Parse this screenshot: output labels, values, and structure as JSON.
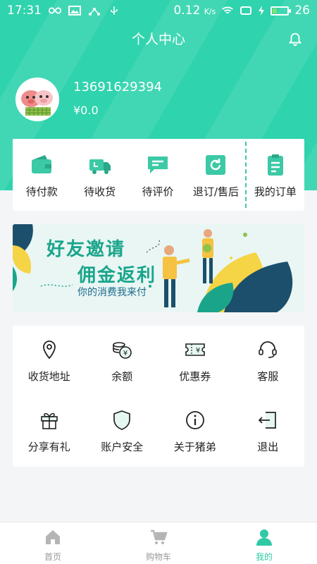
{
  "status_bar": {
    "time": "17:31",
    "net_speed": "0.12",
    "net_unit": "K/s",
    "battery": "26"
  },
  "header": {
    "title": "个人中心"
  },
  "profile": {
    "phone": "13691629394",
    "balance": "¥0.0"
  },
  "orders": [
    {
      "label": "待付款",
      "icon": "wallet-icon"
    },
    {
      "label": "待收货",
      "icon": "truck-icon"
    },
    {
      "label": "待评价",
      "icon": "comment-icon"
    },
    {
      "label": "退订/售后",
      "icon": "refresh-icon"
    },
    {
      "label": "我的订单",
      "icon": "clipboard-icon"
    }
  ],
  "banner": {
    "line1": "好友邀请",
    "line2": "佣金返利",
    "line3": "你的消费我来付"
  },
  "services": [
    {
      "label": "收货地址",
      "icon": "location-icon"
    },
    {
      "label": "余额",
      "icon": "coins-icon"
    },
    {
      "label": "优惠券",
      "icon": "coupon-icon"
    },
    {
      "label": "客服",
      "icon": "headset-icon"
    },
    {
      "label": "分享有礼",
      "icon": "gift-icon"
    },
    {
      "label": "账户安全",
      "icon": "shield-icon"
    },
    {
      "label": "关于猪弟",
      "icon": "info-icon"
    },
    {
      "label": "退出",
      "icon": "logout-icon"
    }
  ],
  "tabs": [
    {
      "label": "首页",
      "icon": "home-icon"
    },
    {
      "label": "购物车",
      "icon": "cart-icon"
    },
    {
      "label": "我的",
      "icon": "user-icon"
    }
  ],
  "colors": {
    "accent": "#2fd3ad",
    "banner_text": "#1aa58b",
    "tab_active": "#2fc9a4"
  }
}
